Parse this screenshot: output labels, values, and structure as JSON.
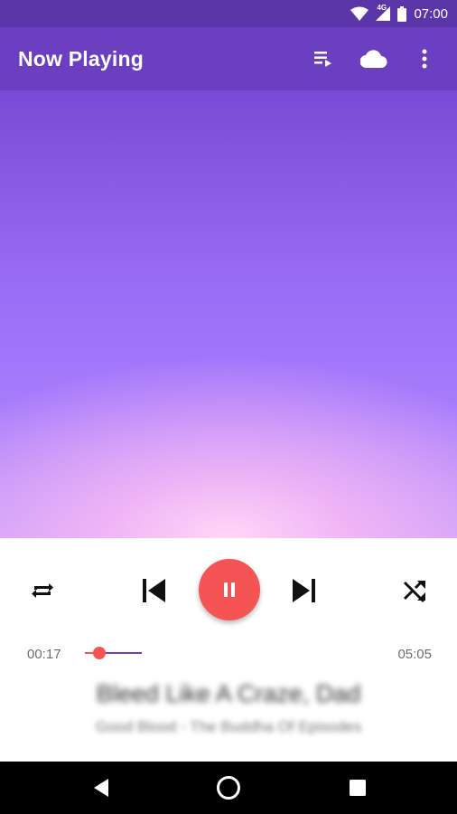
{
  "status_bar": {
    "time": "07:00",
    "network": "4G"
  },
  "app_bar": {
    "title": "Now Playing",
    "actions": [
      "queue-icon",
      "cloud-icon",
      "more-vert-icon"
    ]
  },
  "player": {
    "elapsed": "00:17",
    "duration": "05:05",
    "progress_fraction": 0.056,
    "state": "playing",
    "song_title": "Bleed Like A Craze, Dad",
    "song_subtitle": "Good Blood - The Buddha Of Episodes"
  },
  "colors": {
    "primary": "#6b3fbf",
    "primary_dark": "#5b36a8",
    "accent": "#f45454"
  },
  "nav_bar": {
    "buttons": [
      "back-icon",
      "home-icon",
      "recents-icon"
    ]
  }
}
